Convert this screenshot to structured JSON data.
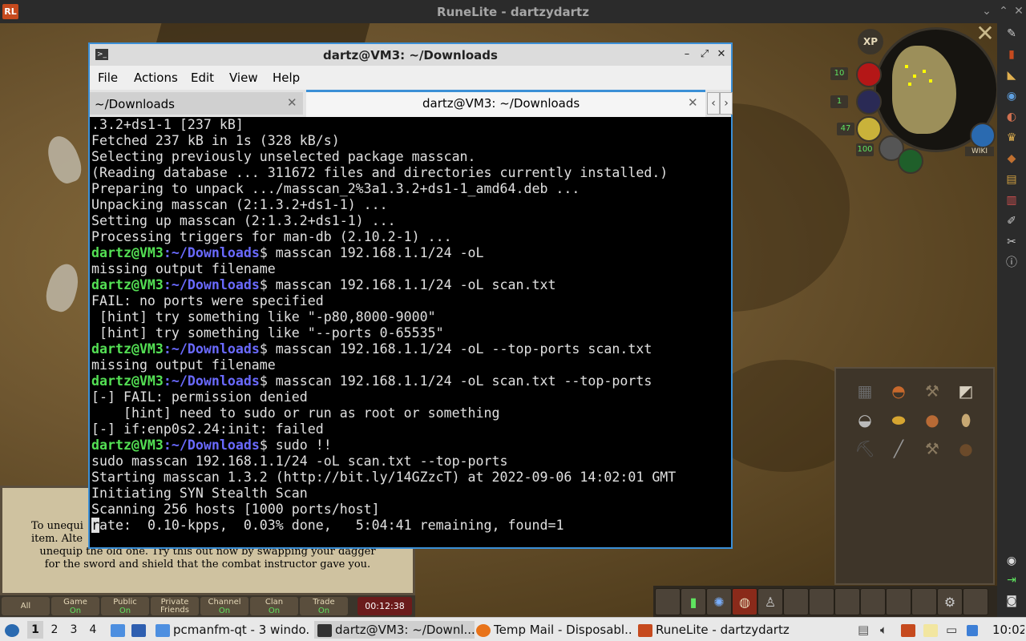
{
  "runelite": {
    "title": "RuneLite - dartzydartz",
    "logo": "RL"
  },
  "minimap": {
    "xp_label": "XP",
    "hp": "10",
    "prayer": "1",
    "run": "47",
    "spec": "100",
    "wiki_label": "WIKI"
  },
  "chat": {
    "message": "To unequip your current item. Alternatively, you can unequip the old one. Try this out now by swapping your dagger for the sword and shield that the combat instructor gave you.",
    "message_line1": "To unequi                                   ",
    "message_line2": "item. Alte",
    "message_line3": "unequip the old one. Try this out now by swapping your dagger",
    "message_line4": "for the sword and shield that the combat instructor gave you.",
    "tabs": [
      {
        "name": "All",
        "value": ""
      },
      {
        "name": "Game",
        "value": "On"
      },
      {
        "name": "Public",
        "value": "On"
      },
      {
        "name": "Private Friends",
        "value": ""
      },
      {
        "name": "Channel",
        "value": "On"
      },
      {
        "name": "Clan",
        "value": "On"
      },
      {
        "name": "Trade",
        "value": "On"
      }
    ],
    "clock": "00:12:38"
  },
  "terminal": {
    "title": "dartz@VM3: ~/Downloads",
    "menu": [
      "File",
      "Actions",
      "Edit",
      "View",
      "Help"
    ],
    "tabs": [
      {
        "label": "~/Downloads"
      },
      {
        "label": "dartz@VM3: ~/Downloads"
      }
    ],
    "prompt_user": "dartz@VM3",
    "prompt_path": ":~/Downloads",
    "lines": [
      {
        "type": "out",
        "text": ".3.2+ds1-1 [237 kB]"
      },
      {
        "type": "out",
        "text": "Fetched 237 kB in 1s (328 kB/s)"
      },
      {
        "type": "out",
        "text": "Selecting previously unselected package masscan."
      },
      {
        "type": "out",
        "text": "(Reading database ... 311672 files and directories currently installed.)"
      },
      {
        "type": "out",
        "text": "Preparing to unpack .../masscan_2%3a1.3.2+ds1-1_amd64.deb ..."
      },
      {
        "type": "out",
        "text": "Unpacking masscan (2:1.3.2+ds1-1) ..."
      },
      {
        "type": "out",
        "text": "Setting up masscan (2:1.3.2+ds1-1) ..."
      },
      {
        "type": "out",
        "text": "Processing triggers for man-db (2.10.2-1) ..."
      },
      {
        "type": "cmd",
        "text": "$ masscan 192.168.1.1/24 -oL"
      },
      {
        "type": "out",
        "text": "missing output filename"
      },
      {
        "type": "cmd",
        "text": "$ masscan 192.168.1.1/24 -oL scan.txt"
      },
      {
        "type": "out",
        "text": "FAIL: no ports were specified"
      },
      {
        "type": "out",
        "text": " [hint] try something like \"-p80,8000-9000\""
      },
      {
        "type": "out",
        "text": " [hint] try something like \"--ports 0-65535\""
      },
      {
        "type": "cmd",
        "text": "$ masscan 192.168.1.1/24 -oL --top-ports scan.txt"
      },
      {
        "type": "out",
        "text": "missing output filename"
      },
      {
        "type": "cmd",
        "text": "$ masscan 192.168.1.1/24 -oL scan.txt --top-ports"
      },
      {
        "type": "out",
        "text": "[-] FAIL: permission denied"
      },
      {
        "type": "out",
        "text": "    [hint] need to sudo or run as root or something"
      },
      {
        "type": "out",
        "text": "[-] if:enp0s2.24:init: failed"
      },
      {
        "type": "cmd",
        "text": "$ sudo !!"
      },
      {
        "type": "out",
        "text": "sudo masscan 192.168.1.1/24 -oL scan.txt --top-ports"
      },
      {
        "type": "out",
        "text": "Starting masscan 1.3.2 (http://bit.ly/14GZzcT) at 2022-09-06 14:02:01 GMT"
      },
      {
        "type": "out",
        "text": "Initiating SYN Stealth Scan"
      },
      {
        "type": "out",
        "text": "Scanning 256 hosts [1000 ports/host]"
      },
      {
        "type": "last",
        "text": "ate:  0.10-kpps,  0.03% done,   5:04:41 remaining, found=1",
        "cursor_char": "r"
      }
    ]
  },
  "taskbar": {
    "workspaces": [
      "1",
      "2",
      "3",
      "4"
    ],
    "items": [
      {
        "label": "pcmanfm-qt - 3 windo...",
        "icon": "folder-icon"
      },
      {
        "label": "dartz@VM3: ~/Downl...",
        "icon": "terminal-icon"
      },
      {
        "label": "Temp Mail - Disposabl...",
        "icon": "firefox-icon"
      },
      {
        "label": "RuneLite - dartzydartz",
        "icon": "runelite-icon"
      }
    ],
    "clock": "10:02"
  }
}
